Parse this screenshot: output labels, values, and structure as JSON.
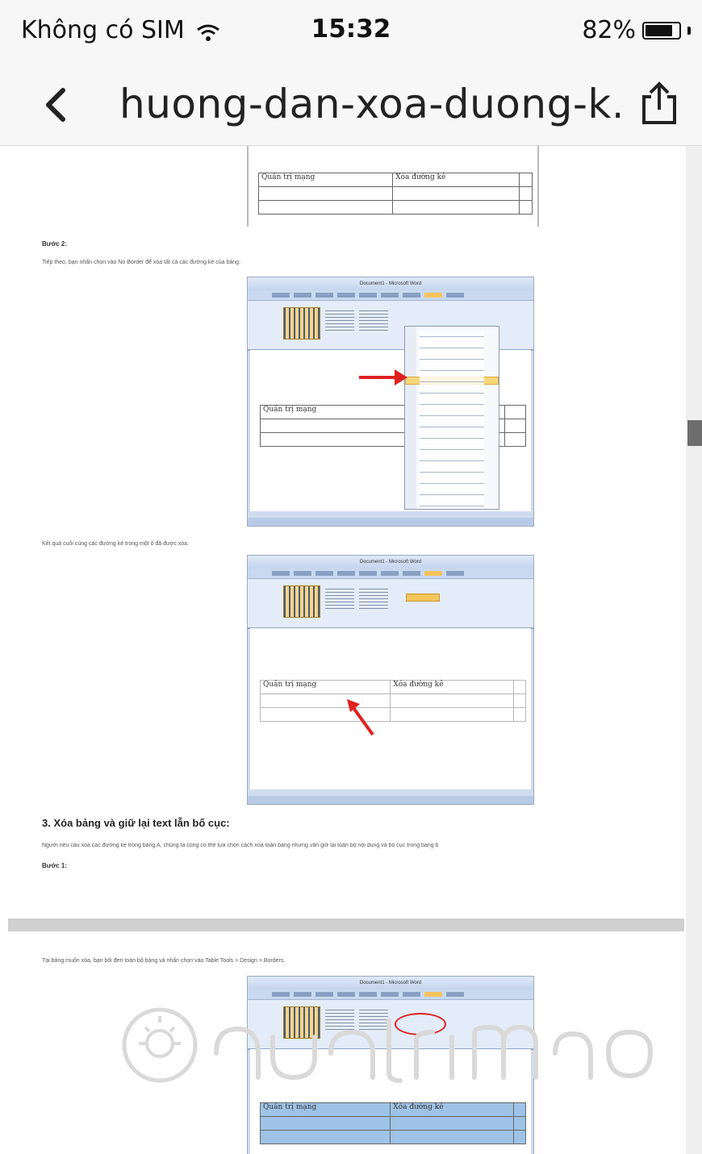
{
  "status_bar": {
    "carrier": "Không có SIM",
    "time": "15:32",
    "battery_percent": "82%",
    "battery_level": 0.82
  },
  "nav": {
    "title": "huong-dan-xoa-duong-k...",
    "back_icon": "chevron-left-icon",
    "share_icon": "share-icon"
  },
  "article": {
    "step2_label": "Bước 2:",
    "step2_text": "Tiếp theo, bạn nhấn chọn vào No Border để xóa tất cả các đường kẻ của bảng:",
    "result_text": "Kết quả cuối cùng các đường kẻ trong một ô đã được xóa.",
    "section3_heading": "3. Xóa bảng và giữ lại text lẫn bố cục:",
    "section3_text": "Người nếu cầu xóa các đường kẻ trong bảng A, chúng ta cũng có thể lựa chọn cách xóa toàn bảng nhưng vẫn giữ lại toàn bộ nội dung và bố cục trong bảng b",
    "step1_label": "Bước 1:",
    "step1_text": "Tại bảng muốn xóa, bạn bôi đen toàn bộ bảng và nhấn chọn vào Table Tools > Design > Borders."
  },
  "word_table": {
    "header_col1": "Quản trị mạng",
    "header_col2": "Xóa đường kẻ"
  },
  "screenshot_window": {
    "title": "Document1 - Microsoft Word"
  },
  "colors": {
    "nav_bg": "#f7f7f7",
    "scroll_thumb": "#6d6d6d",
    "word_ribbon": "#c9d9ef",
    "annotation_red": "#e02020"
  }
}
